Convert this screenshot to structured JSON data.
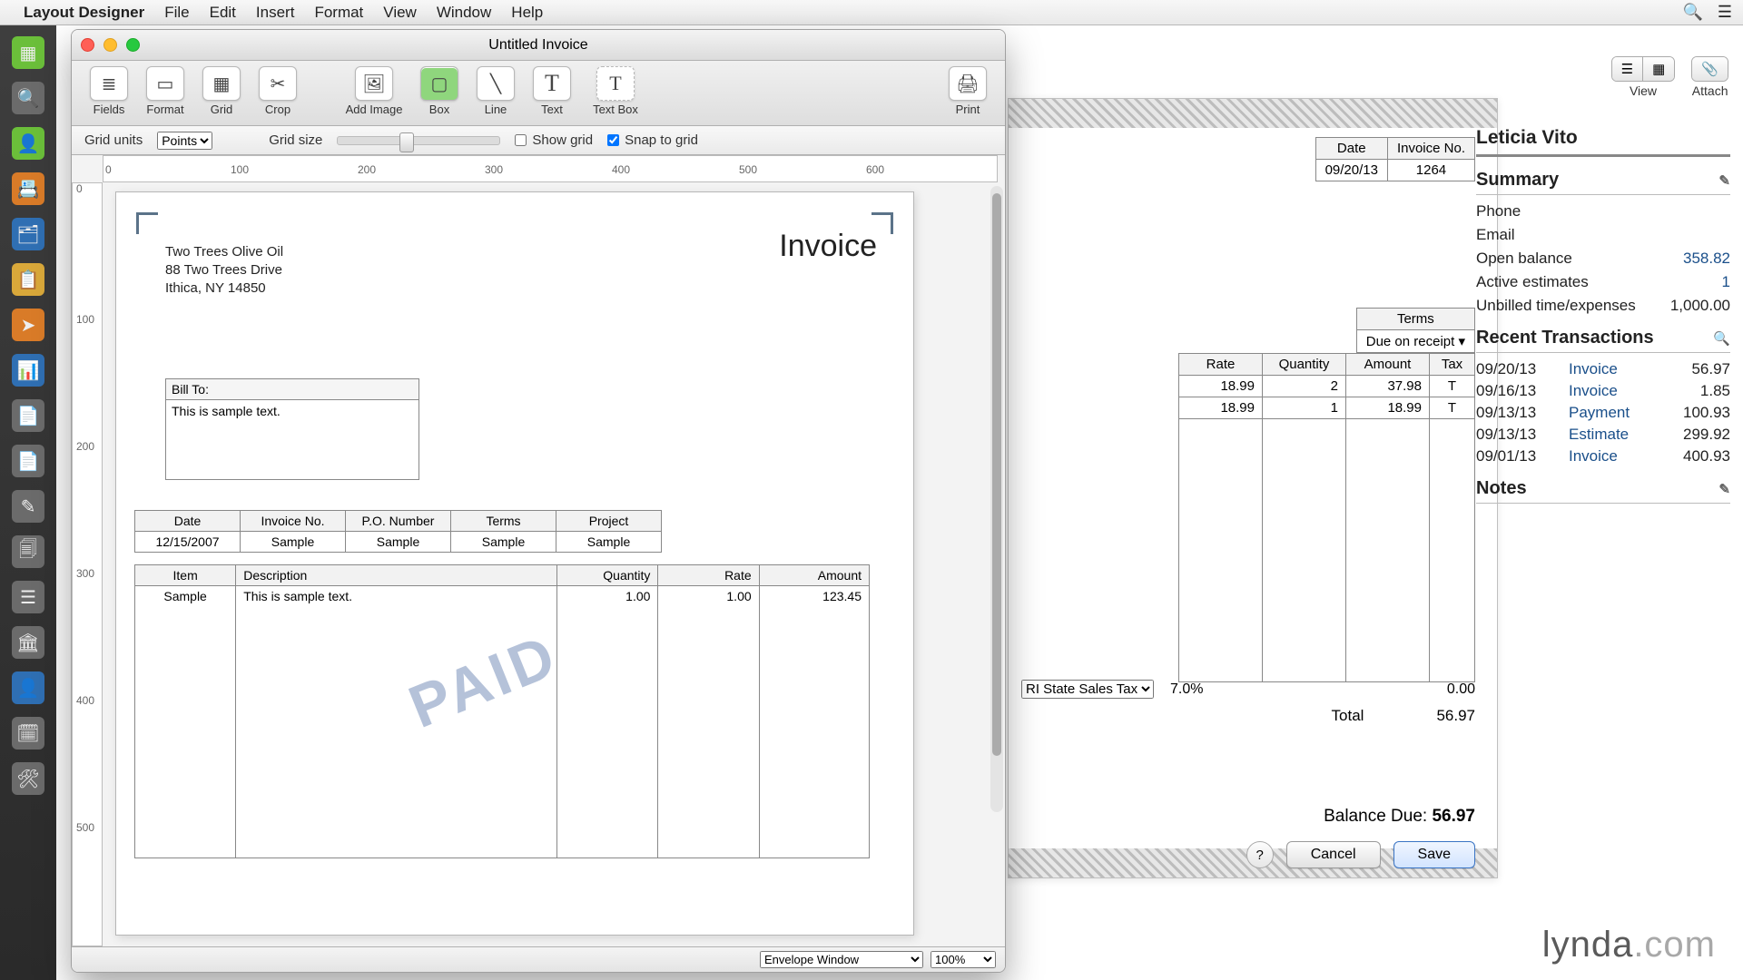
{
  "menubar": {
    "app": "Layout Designer",
    "items": [
      "File",
      "Edit",
      "Insert",
      "Format",
      "View",
      "Window",
      "Help"
    ]
  },
  "dock_count": 17,
  "window": {
    "title": "Untitled Invoice",
    "toolbar": {
      "fields": "Fields",
      "format": "Format",
      "grid": "Grid",
      "crop": "Crop",
      "add_image": "Add Image",
      "box": "Box",
      "line": "Line",
      "text": "Text",
      "text_box": "Text Box",
      "print": "Print"
    },
    "optbar": {
      "grid_units_label": "Grid units",
      "grid_units_value": "Points",
      "grid_size_label": "Grid size",
      "show_grid_label": "Show grid",
      "snap_label": "Snap to grid"
    },
    "status": {
      "preset": "Envelope Window",
      "zoom": "100%"
    }
  },
  "page": {
    "company": {
      "l1": "Two Trees Olive Oil",
      "l2": "88 Two Trees Drive",
      "l3": "Ithica, NY 14850"
    },
    "title": "Invoice",
    "billto": {
      "header": "Bill To:",
      "body": "This is sample text."
    },
    "meta": {
      "headers": [
        "Date",
        "Invoice No.",
        "P.O. Number",
        "Terms",
        "Project"
      ],
      "values": [
        "12/15/2007",
        "Sample",
        "Sample",
        "Sample",
        "Sample"
      ]
    },
    "items": {
      "headers": [
        "Item",
        "Description",
        "Quantity",
        "Rate",
        "Amount"
      ],
      "row": [
        "Sample",
        "This is sample text.",
        "1.00",
        "1.00",
        "123.45"
      ]
    },
    "watermark": "PAID"
  },
  "bg": {
    "date_header": "Date",
    "inv_header": "Invoice No.",
    "date_value": "09/20/13",
    "inv_value": "1264",
    "terms_header": "Terms",
    "terms_value": "Due on receipt",
    "line_headers": [
      "Rate",
      "Quantity",
      "Amount",
      "Tax"
    ],
    "lines": [
      [
        "18.99",
        "2",
        "37.98",
        "T"
      ],
      [
        "18.99",
        "1",
        "18.99",
        "T"
      ]
    ],
    "tax_select": "RI State Sales Tax",
    "tax_pct": "7.0%",
    "tax_amt": "0.00",
    "total_label": "Total",
    "total_value": "56.97",
    "balance_label": "Balance Due:",
    "balance_value": "56.97",
    "cancel": "Cancel",
    "save": "Save"
  },
  "topright": {
    "view": "View",
    "attach": "Attach"
  },
  "right": {
    "customer": "Leticia Vito",
    "summary_label": "Summary",
    "rows": {
      "phone": "Phone",
      "email": "Email",
      "open_bal_l": "Open balance",
      "open_bal_v": "358.82",
      "act_est_l": "Active estimates",
      "act_est_v": "1",
      "unbill_l": "Unbilled time/expenses",
      "unbill_v": "1,000.00"
    },
    "recent_label": "Recent Transactions",
    "tx": [
      {
        "d": "09/20/13",
        "t": "Invoice",
        "a": "56.97"
      },
      {
        "d": "09/16/13",
        "t": "Invoice",
        "a": "1.85"
      },
      {
        "d": "09/13/13",
        "t": "Payment",
        "a": "100.93"
      },
      {
        "d": "09/13/13",
        "t": "Estimate",
        "a": "299.92"
      },
      {
        "d": "09/01/13",
        "t": "Invoice",
        "a": "400.93"
      }
    ],
    "notes_label": "Notes"
  },
  "watermark_brand": "lynda.com"
}
